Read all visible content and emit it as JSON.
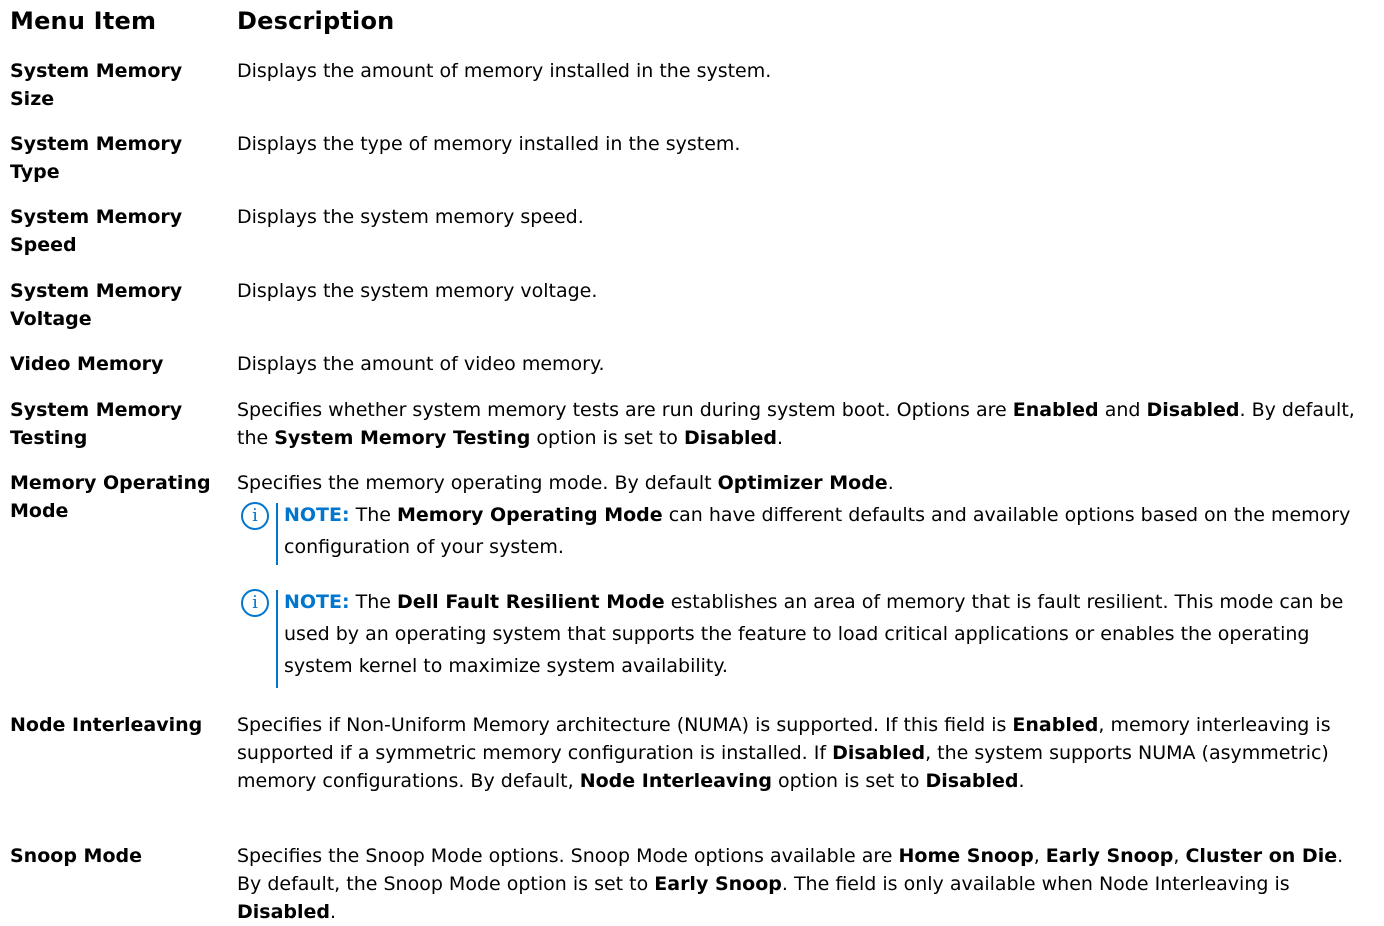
{
  "header": {
    "menu_item": "Menu Item",
    "description": "Description"
  },
  "rows": [
    {
      "label": "System Memory Size",
      "desc": "Displays the amount of memory installed in the system."
    },
    {
      "label": "System Memory Type",
      "desc": "Displays the type of memory installed in the system."
    },
    {
      "label": "System Memory Speed",
      "desc": "Displays the system memory speed."
    },
    {
      "label": "System Memory Voltage",
      "desc": "Displays the system memory voltage."
    },
    {
      "label": "Video Memory",
      "desc": "Displays the amount of video memory."
    },
    {
      "label": "System Memory Testing",
      "desc": {
        "p1": "Specifies whether system memory tests are run during system boot. Options are ",
        "b1": "Enabled",
        "p2": " and ",
        "b2": "Disabled",
        "p3": ". By default, the ",
        "b3": "System Memory Testing",
        "p4": " option is set to ",
        "b4": "Disabled",
        "p5": "."
      }
    },
    {
      "label": "Memory Operating Mode",
      "desc": {
        "p1": "Specifies the memory operating mode. By default ",
        "b1": "Optimizer Mode",
        "p2": "."
      }
    },
    {
      "label": "Node Interleaving",
      "desc": {
        "p1": "Specifies if Non-Uniform Memory architecture (NUMA) is supported. If this field is ",
        "b1": "Enabled",
        "p2": ", memory interleaving is supported if a symmetric memory configuration is installed. If ",
        "b2": "Disabled",
        "p3": ", the system supports NUMA (asymmetric) memory configurations. By default, ",
        "b3": "Node Interleaving",
        "p4": " option is set to ",
        "b4": "Disabled",
        "p5": "."
      }
    },
    {
      "label": "Snoop Mode",
      "desc": {
        "p1": "Specifies the Snoop Mode options. Snoop Mode options available are ",
        "b1": "Home Snoop",
        "p2": ", ",
        "b2": "Early Snoop",
        "p3": ", ",
        "b3": "Cluster on Die",
        "p4": ". By default, the Snoop Mode option is set to ",
        "b4": "Early Snoop",
        "p5": ". The field is only available when Node Interleaving is ",
        "b5": "Disabled",
        "p6": "."
      }
    }
  ],
  "notes": [
    {
      "icon": "info-icon",
      "kw": "NOTE:",
      "p1": " The ",
      "b1": "Memory Operating Mode",
      "p2": " can have different defaults and available options based on the memory configuration of your system."
    },
    {
      "icon": "info-icon",
      "kw": "NOTE:",
      "p1": " The ",
      "b1": "Dell Fault Resilient Mode",
      "p2": " establishes an area of memory that is fault resilient. This mode can be used by an operating system that supports the feature to load critical applications or enables the operating system kernel to maximize system availability."
    }
  ],
  "colors": {
    "accent": "#0076ce",
    "text": "#000000"
  }
}
